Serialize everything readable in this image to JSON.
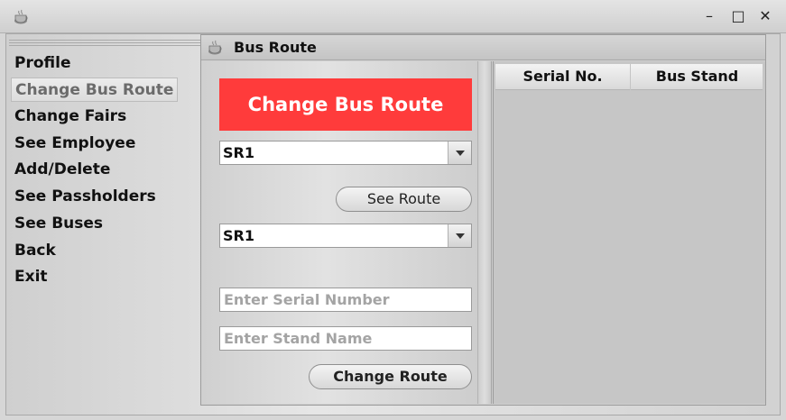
{
  "window": {
    "minimize": "–",
    "maximize": "□",
    "close": "✕"
  },
  "sidebar": {
    "items": [
      {
        "label": "Profile"
      },
      {
        "label": "Change Bus Route",
        "selected": true
      },
      {
        "label": "Change Fairs"
      },
      {
        "label": "See Employee"
      },
      {
        "label": "Add/Delete"
      },
      {
        "label": "See Passholders"
      },
      {
        "label": "See Buses"
      },
      {
        "label": "Back"
      },
      {
        "label": "Exit"
      }
    ]
  },
  "internal_frame": {
    "title": "Bus Route",
    "banner": "Change Bus Route",
    "banner_color": "#ff3b3b",
    "route_combo_1": {
      "value": "SR1"
    },
    "see_route_label": "See Route",
    "route_combo_2": {
      "value": "SR1"
    },
    "serial_input": {
      "value": "",
      "placeholder": "Enter Serial Number"
    },
    "stand_input": {
      "value": "",
      "placeholder": "Enter Stand Name"
    },
    "change_route_label": "Change Route"
  },
  "table": {
    "columns": [
      "Serial No.",
      "Bus Stand"
    ],
    "rows": []
  }
}
